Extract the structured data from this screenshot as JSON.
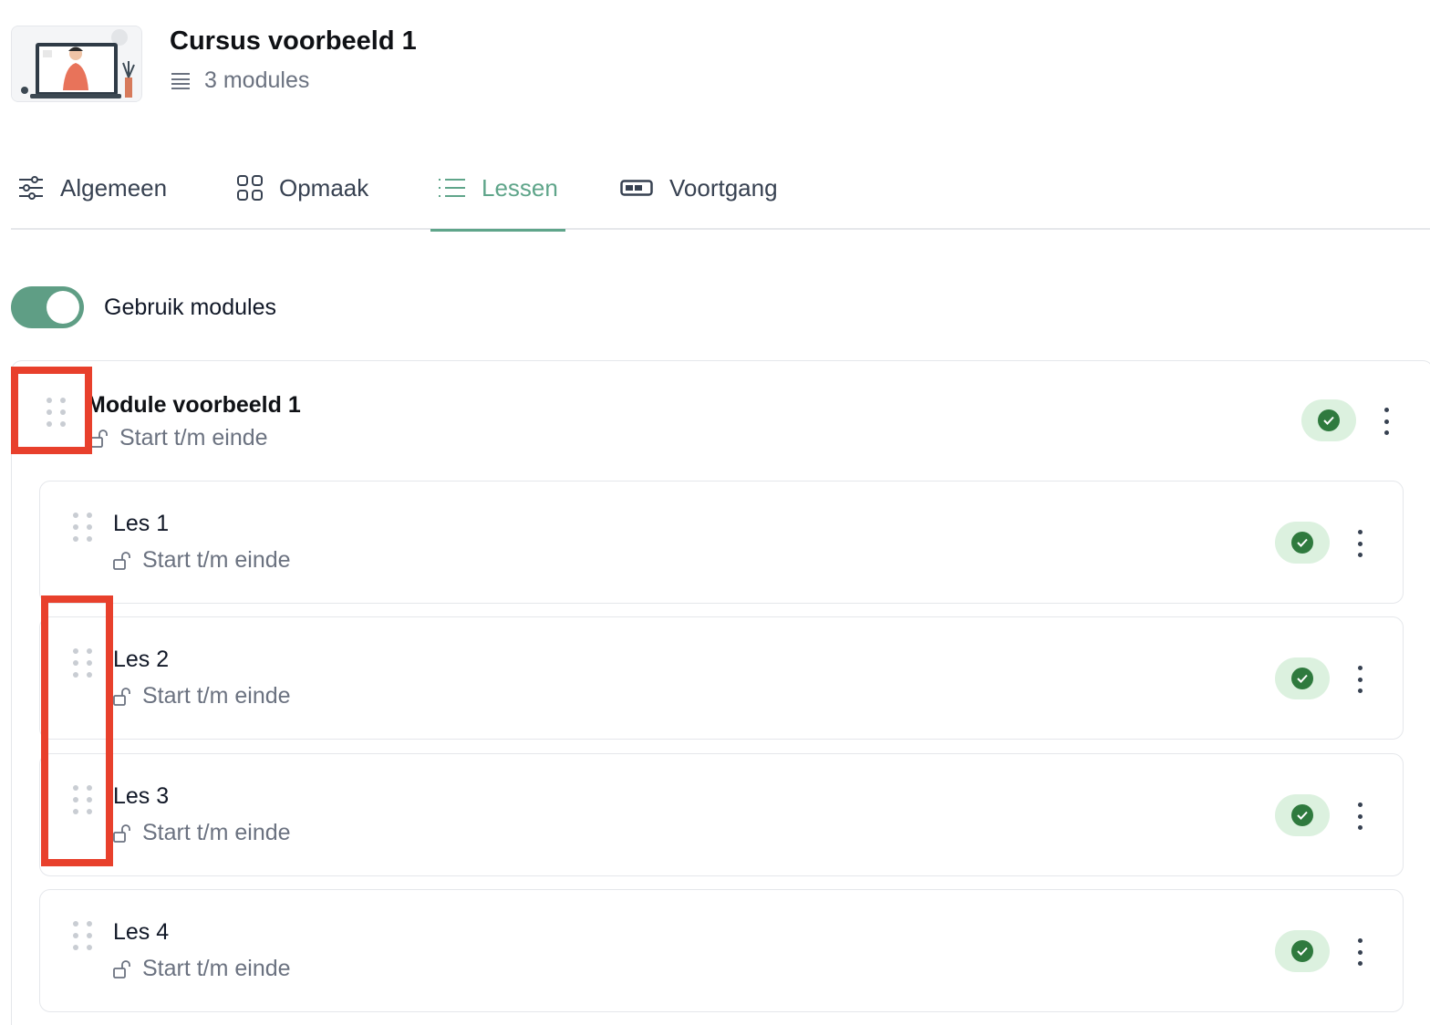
{
  "course": {
    "title": "Cursus voorbeeld 1",
    "modules_count": "3 modules"
  },
  "tabs": [
    {
      "label": "Algemeen",
      "icon": "sliders-icon",
      "active": false
    },
    {
      "label": "Opmaak",
      "icon": "grid-icon",
      "active": false
    },
    {
      "label": "Lessen",
      "icon": "list-icon",
      "active": true
    },
    {
      "label": "Voortgang",
      "icon": "progress-bar-icon",
      "active": false
    }
  ],
  "toggle": {
    "label": "Gebruik modules",
    "on": true
  },
  "module": {
    "title": "Module voorbeeld 1",
    "availability": "Start t/m einde",
    "status_icon": "check-icon"
  },
  "lessons": [
    {
      "title": "Les 1",
      "availability": "Start t/m einde"
    },
    {
      "title": "Les 2",
      "availability": "Start t/m einde"
    },
    {
      "title": "Les 3",
      "availability": "Start t/m einde"
    },
    {
      "title": "Les 4",
      "availability": "Start t/m einde"
    }
  ],
  "colors": {
    "accent": "#5fa58a",
    "toggle_bg": "#5f9e85",
    "status_bg": "#dcf1df",
    "status_dot": "#2f7a3e",
    "annotation": "#e8402c"
  }
}
